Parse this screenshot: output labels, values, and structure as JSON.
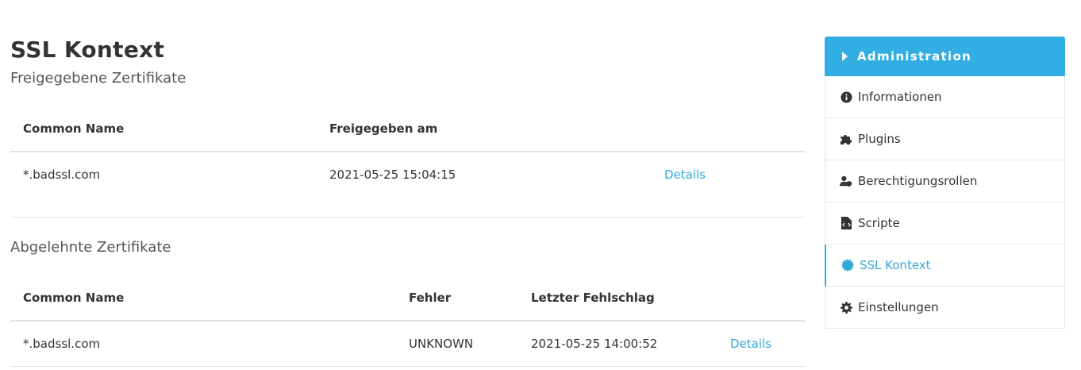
{
  "page": {
    "title": "SSL Kontext",
    "subtitle": "Freigegebene Zertifikate"
  },
  "approved": {
    "headers": [
      "Common Name",
      "Freigegeben am"
    ],
    "rows": [
      {
        "common_name": "*.badssl.com",
        "approved_at": "2021-05-25 15:04:15",
        "action": "Details"
      }
    ]
  },
  "rejected": {
    "title": "Abgelehnte Zertifikate",
    "headers": [
      "Common Name",
      "Fehler",
      "Letzter Fehlschlag"
    ],
    "rows": [
      {
        "common_name": "*.badssl.com",
        "error": "UNKNOWN",
        "last_failure": "2021-05-25 14:00:52",
        "action": "Details"
      }
    ]
  },
  "sidebar": {
    "title": "Administration",
    "items": [
      {
        "label": "Informationen",
        "icon": "info-circle-icon"
      },
      {
        "label": "Plugins",
        "icon": "puzzle-icon"
      },
      {
        "label": "Berechtigungsrollen",
        "icon": "user-shield-icon"
      },
      {
        "label": "Scripte",
        "icon": "file-code-icon"
      },
      {
        "label": "SSL Kontext",
        "icon": "certificate-icon",
        "active": true
      },
      {
        "label": "Einstellungen",
        "icon": "gear-icon"
      }
    ]
  },
  "colors": {
    "accent": "#33aee2",
    "link": "#33a8d8",
    "text": "#333333"
  }
}
